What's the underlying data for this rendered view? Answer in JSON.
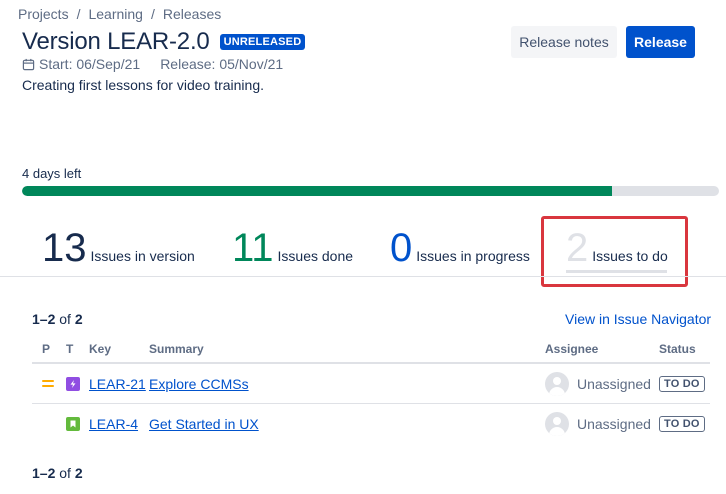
{
  "breadcrumb": [
    "Projects",
    "Learning",
    "Releases"
  ],
  "breadcrumb_separator": "/",
  "version": {
    "title": "Version LEAR-2.0",
    "badge": "UNRELEASED",
    "start": "Start: 06/Sep/21",
    "release": "Release: 05/Nov/21",
    "description": "Creating first lessons for video training."
  },
  "buttons": {
    "notes": "Release notes",
    "release": "Release"
  },
  "progress": {
    "days_left": "4 days left",
    "done_fraction": 0.846
  },
  "stats": [
    {
      "num": "13",
      "label": "Issues in version"
    },
    {
      "num": "11",
      "label": "Issues done"
    },
    {
      "num": "0",
      "label": "Issues in progress"
    },
    {
      "num": "2",
      "label": "Issues to do"
    }
  ],
  "pagination": {
    "range": "1–2",
    "of": "of",
    "total": "2"
  },
  "navigator_link": "View in Issue Navigator",
  "table": {
    "headers": {
      "p": "P",
      "t": "T",
      "key": "Key",
      "summary": "Summary",
      "assignee": "Assignee",
      "status": "Status"
    },
    "rows": [
      {
        "priority": "medium-priority",
        "type": "epic",
        "key": "LEAR-21",
        "summary": "Explore CCMSs",
        "assignee": "Unassigned",
        "status": "TO DO"
      },
      {
        "priority": "",
        "type": "story",
        "key": "LEAR-4",
        "summary": "Get Started in UX",
        "assignee": "Unassigned",
        "status": "TO DO"
      }
    ]
  },
  "colors": {
    "primary": "#0052cc",
    "done": "#00875a",
    "todo": "#dfe1e6",
    "highlight": "#d9363e",
    "epic": "#904ee2",
    "story": "#63ba3c",
    "priority_medium": "#ffab00"
  }
}
